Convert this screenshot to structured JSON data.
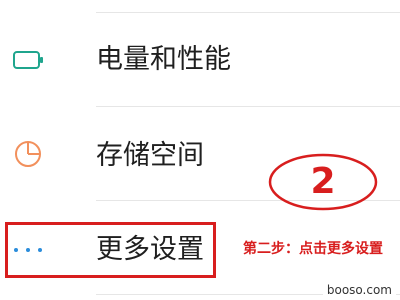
{
  "settings": {
    "items": [
      {
        "label": "电量和性能",
        "icon": "battery-icon",
        "color": "#1fa58d"
      },
      {
        "label": "存储空间",
        "icon": "pie-chart-icon",
        "color": "#f2905c"
      },
      {
        "label": "更多设置",
        "icon": "more-dots-icon",
        "color": "#2b8ddb"
      }
    ]
  },
  "annotation": {
    "step_number": "2",
    "step_caption": "第二步：点击更多设置",
    "color": "#d81e1e"
  },
  "watermark": {
    "text": "booso.com"
  }
}
